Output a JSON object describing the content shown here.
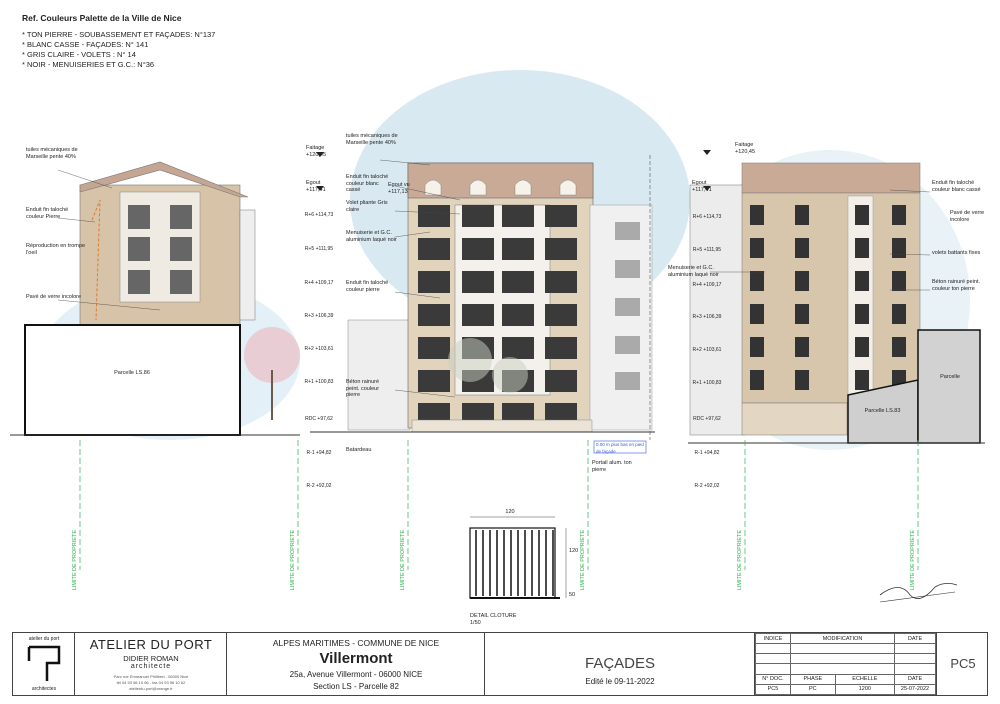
{
  "header": {
    "title": "Ref. Couleurs Palette de la Ville de Nice",
    "colors": [
      "* TON PIERRE - SOUBASSEMENT ET FAÇADES: N°137",
      "* BLANC CASSE - FAÇADES: N°  141",
      "* GRIS CLAIRE - VOLETS : N° 14",
      "* NOIR - MENUISERIES ET G.C.: N°36"
    ]
  },
  "left_elevation": {
    "labels": {
      "tuiles": "tuiles mécaniques de Marseille pente 40%",
      "enduit": "Enduit fin taloché couleur Pierre",
      "reproduction": "Réproduction en trompe l'oeil",
      "pave": "Pavé de verre incolore",
      "parcelle": "Parcelle LS.86"
    }
  },
  "center_elevation": {
    "labels": {
      "faitage": "Faitage +120,45",
      "tuiles": "tuiles mécaniques de Marseille pente 40%",
      "egout": "Egout +117,41",
      "egout2": "Egout vu +117,13",
      "enduit1": "Enduit fin taloché couleur blanc cassé",
      "volet": "Volet pliante Gris claire",
      "menuiserie": "Menuiserie et G.C. aluminium laqué noir",
      "enduit2": "Enduit fin taloché couleur pierre",
      "beton": "Béton rainuré peint. couleur pierre",
      "batardeau": "Batardeau",
      "portail": "Portail alum. ton pierre",
      "blue_note": "0.00 m plus bas en pied de façade"
    },
    "levels": [
      "R+6 +114,73",
      "R+5 +111,95",
      "R+4 +109,17",
      "R+3 +106,39",
      "R+2 +103,61",
      "R+1 +100,83",
      "RDC +97,62",
      "R-1 +94,82",
      "R-2 +92,02"
    ]
  },
  "right_elevation": {
    "labels": {
      "faitage": "Faitage +120,45",
      "egout": "Egout +117,41",
      "enduit": "Enduit fin taloché couleur blanc cassé",
      "pave": "Pavé de verre incolore",
      "volets": "volets battants fixes",
      "menuiserie": "Menuiserie et G.C. aluminium laqué noir",
      "beton": "Béton rainuré peint. couleur ton pierre",
      "parcelle1": "Parcelle",
      "parcelle2": "Parcelle LS.83"
    },
    "levels": [
      "R+6 +114,73",
      "R+5 +111,95",
      "R+4 +109,17",
      "R+3 +106,39",
      "R+2 +103,61",
      "R+1 +100,83",
      "RDC +97,62",
      "R-1 +94,82",
      "R-2 +92,02"
    ]
  },
  "limite_label": "LIMITE DE PROPRIETE",
  "detail": {
    "dim_width": "120",
    "dim_height": "120",
    "dim_base": "50",
    "title": "DETAIL CLOTURE",
    "scale": "1/50"
  },
  "titleblock": {
    "firm_logo_text": "atelier du port",
    "firm_logo_sub": "architectes",
    "firm": "ATELIER DU PORT",
    "architect": "DIDIER ROMAN",
    "role": "architecte",
    "address": "Parc rue Emmanuel Philibert - 06300 Nice",
    "phone": "tél 04 93 56 10 66 - fax 04 93 56 10 62",
    "email": "atelierdu.port@orange.fr",
    "region": "ALPES MARITIMES - COMMUNE DE NICE",
    "project": "Villermont",
    "project_address": "25a, Avenue Villermont - 06000 NICE",
    "section": "Section LS - Parcelle 82",
    "sheet_title": "FAÇADES",
    "edited": "Edité le 09-11-2022",
    "rev_headers": [
      "INDICE",
      "MODIFICATION",
      "DATE"
    ],
    "doc_headers": [
      "N° DOC.",
      "PHASE",
      "ECHELLE",
      "DATE"
    ],
    "doc_values": [
      "PC5",
      "PC",
      "1200",
      "25-07-2022"
    ],
    "code": "PC5"
  },
  "colors": {
    "stone": "#d6c3a8",
    "roof": "#c9aa96",
    "sky": "#cfe3ef",
    "limit_line": "#2bb24c",
    "blue_note": "#3a5bd9"
  }
}
